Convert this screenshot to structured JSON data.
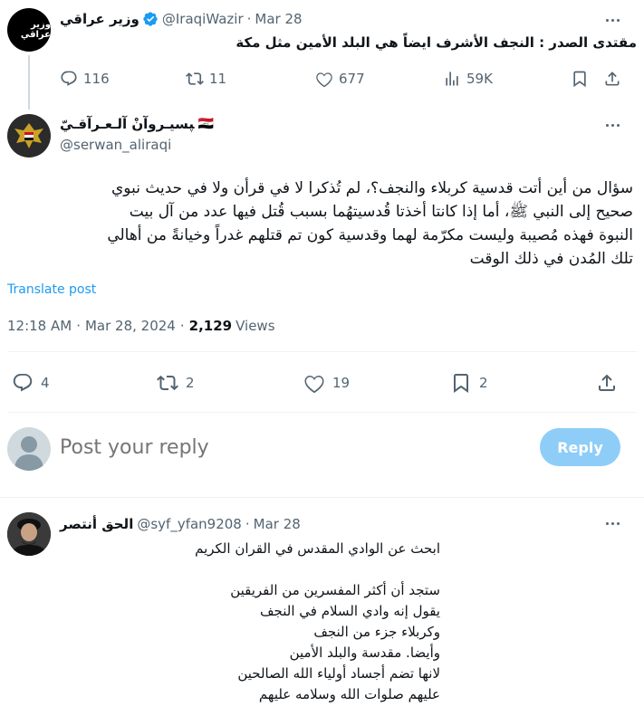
{
  "parent_tweet": {
    "display_name": "وزير عراقي",
    "handle": "@IraqiWazir",
    "separator": "·",
    "date": "Mar 28",
    "avatar_text": "وزير عراقي",
    "text": "مقتدى الصدر : النجف الأشرف ايضاً هي البلد الأمين مثل مكة",
    "replies": "116",
    "retweets": "11",
    "likes": "677",
    "views": "59K"
  },
  "main_tweet": {
    "display_name": "ﭙﺴﻴـﺮوآنْ آلـﻌـﺮآﻗـﻲّ",
    "flag": "🇮🇶",
    "handle": "@serwan_aliraqi",
    "lines": [
      "سؤال من أين أتت قدسية كربلاء والنجف؟، لم تُذكرا لا في قرأن ولا في حديث نبوي",
      "صحيح إلى النبي ﷺ، أما إذا كانتا أخذتا قُدسيتهُما بسبب قُتل فيها عدد من آل بيت",
      "النبوة فهذه مُصيبة وليست مكرّمة لهما وقدسية كون تم قتلهم غدراً وخيانةً من أهالي",
      "تلك المُدن في ذلك الوقت"
    ],
    "translate": "Translate post",
    "time": "12:18 AM",
    "separator": "·",
    "date": "Mar 28, 2024",
    "separator2": "·",
    "views_count": "2,129",
    "views_label": "Views",
    "replies": "4",
    "retweets": "2",
    "likes": "19",
    "bookmarks": "2"
  },
  "reply_box": {
    "placeholder": "Post your reply",
    "button": "Reply"
  },
  "reply_tweet": {
    "display_name": "الحق أنتصر",
    "handle": "@syf_yfan9208",
    "separator": "·",
    "date": "Mar 28",
    "lines": [
      "ابحث عن الوادي المقدس في القران الكريم",
      "",
      "ستجد أن أكثر المفسرين من الفريقين",
      "يقول إنه وادي السلام في النجف",
      "وكربلاء جزء من النجف",
      "وأيضا. مقدسة  والبلد الأمين",
      "لانها تضم أجساد أولياء الله الصالحين",
      "عليهم صلوات الله وسلامه عليهم"
    ]
  },
  "colors": {
    "accent": "#1d9bf0",
    "reply_button_disabled": "#8ecdf8",
    "muted": "#536471",
    "divider": "#eff3f4",
    "thread_line": "#cfd9de"
  },
  "icons": {
    "verified": "verified-badge-icon",
    "reply": "reply-icon",
    "retweet": "retweet-icon",
    "like": "heart-icon",
    "views": "views-icon",
    "bookmark": "bookmark-icon",
    "share": "share-icon",
    "more": "more-icon"
  }
}
